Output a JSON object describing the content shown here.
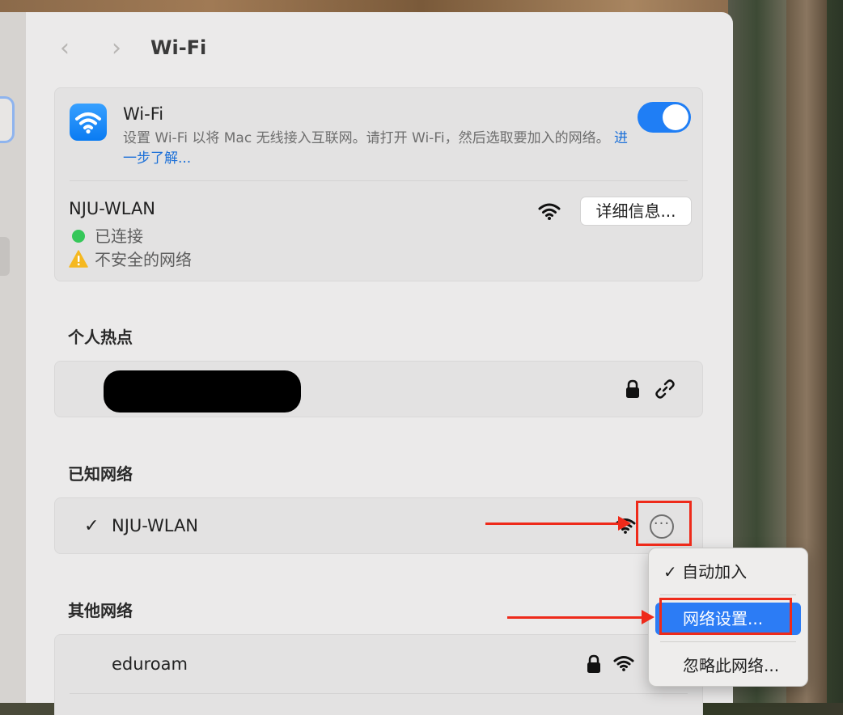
{
  "window": {
    "title": "Wi-Fi"
  },
  "wifi": {
    "title": "Wi-Fi",
    "description": "设置 Wi-Fi 以将 Mac 无线接入互联网。请打开 Wi-Fi，然后选取要加入的网络。",
    "learn_more": "进一步了解...",
    "enabled": true
  },
  "current": {
    "name": "NJU-WLAN",
    "status": "已连接",
    "security": "不安全的网络",
    "details_button": "详细信息..."
  },
  "hotspot": {
    "section_label": "个人热点"
  },
  "known": {
    "section_label": "已知网络",
    "network": "NJU-WLAN",
    "check": "✓"
  },
  "other": {
    "section_label": "其他网络",
    "network": "eduroam"
  },
  "menu": {
    "auto_join": "✓ 自动加入",
    "network_settings": "网络设置...",
    "forget": "忽略此网络..."
  },
  "colors": {
    "accent": "#1f7ef5",
    "annotation": "#ee2a1a",
    "connected": "#35c759"
  }
}
